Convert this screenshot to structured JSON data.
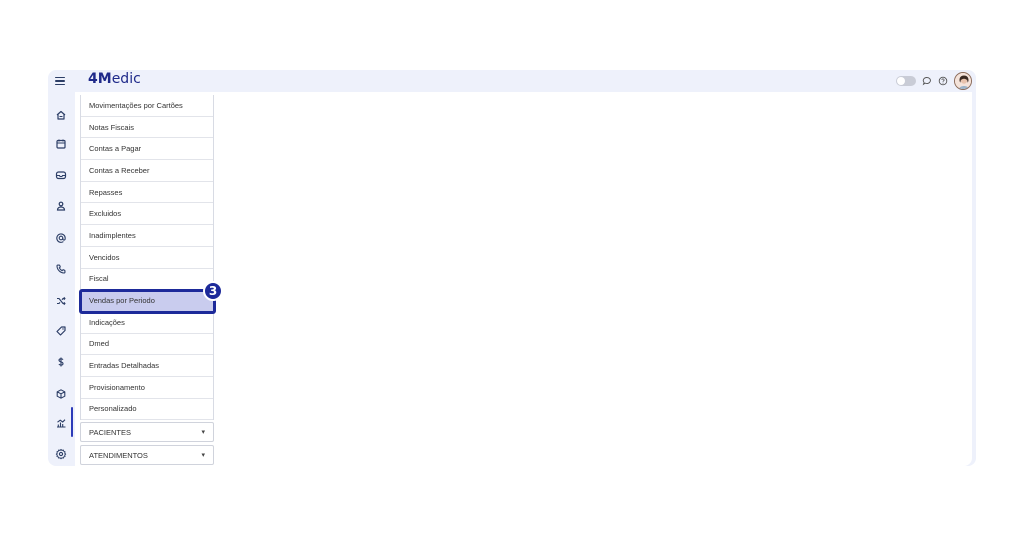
{
  "app": {
    "logo_prefix": "4M",
    "logo_rest": "edic"
  },
  "icons": {
    "menu": "hamburger-icon",
    "home": "home-icon",
    "calendar": "calendar-icon",
    "inbox": "inbox-icon",
    "user": "user-icon",
    "at": "at-icon",
    "phone": "phone-icon",
    "shuffle": "shuffle-icon",
    "tag": "tag-icon",
    "dollar": "dollar-icon",
    "box": "box-icon",
    "chart": "chart-icon",
    "settings": "gear-icon"
  },
  "submenu": {
    "items": [
      {
        "label": "Movimentações por Cartões"
      },
      {
        "label": "Notas Fiscais"
      },
      {
        "label": "Contas a Pagar"
      },
      {
        "label": "Contas a Receber"
      },
      {
        "label": "Repasses"
      },
      {
        "label": "Excluidos"
      },
      {
        "label": "Inadimplentes"
      },
      {
        "label": "Vencidos"
      },
      {
        "label": "Fiscal"
      },
      {
        "label": "Vendas por Periodo"
      },
      {
        "label": "Indicações"
      },
      {
        "label": "Dmed"
      },
      {
        "label": "Entradas Detalhadas"
      },
      {
        "label": "Provisionamento"
      },
      {
        "label": "Personalizado"
      }
    ],
    "selected_index": 9
  },
  "step_badge": "3",
  "dropdowns": [
    {
      "label": "PACIENTES",
      "caret": "▾"
    },
    {
      "label": "ATENDIMENTOS",
      "caret": "▾"
    }
  ],
  "colors": {
    "brand": "#1f2a8a",
    "highlight": "#1d2a9a",
    "selected_bg": "#c9ccee",
    "frame_bg": "#eef1fb"
  }
}
